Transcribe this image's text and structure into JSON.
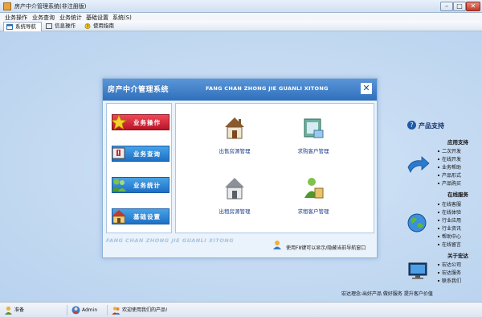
{
  "window": {
    "title": "房产中介管理系统(非注册版)",
    "buttons": {
      "minimize": "–",
      "maximize": "□",
      "close": "✕"
    }
  },
  "menu": [
    "业务操作",
    "业务查询",
    "业务统计",
    "基础设置",
    "系统(S)"
  ],
  "toolbar": {
    "tabs": [
      "系统导航",
      "信息操作",
      "使用指南"
    ]
  },
  "dialog": {
    "title": "房产中介管理系统",
    "pinyin": "FANG CHAN ZHONG JIE GUANLI XITONG",
    "close": "✕",
    "nav": [
      "业务操作",
      "业务查询",
      "业务统计",
      "基础设置"
    ],
    "features": [
      "出售房源管理",
      "求购客户管理",
      "出租房源管理",
      "求租客户管理"
    ],
    "footer_pinyin": "FANG CHAN ZHONG JIE GUANLI XITONG",
    "hint": "使用F8键可以显示/隐藏当前导航窗口"
  },
  "side": {
    "title": "产品支持",
    "groups": [
      {
        "head": "应用支持",
        "items": [
          "二次开发",
          "在线开发",
          "业务帮助",
          "产品形式",
          "产品购买"
        ]
      },
      {
        "head": "在线服务",
        "items": [
          "在线客服",
          "在线体验",
          "行业应用",
          "行业资讯",
          "帮助中心",
          "在线留言"
        ]
      },
      {
        "head": "关于宏达",
        "items": [
          "宏达公司",
          "宏达服务",
          "联系我们"
        ]
      }
    ],
    "motto": "宏达理念:出好产品 做好服务 提升客户价值"
  },
  "status": {
    "ready": "准备",
    "user": "Admin",
    "welcome": "欢迎使用我们的产品!"
  },
  "colors": {
    "accent": "#2f6fbb",
    "active_nav": "#d21e32",
    "nav": "#2a86d6"
  }
}
